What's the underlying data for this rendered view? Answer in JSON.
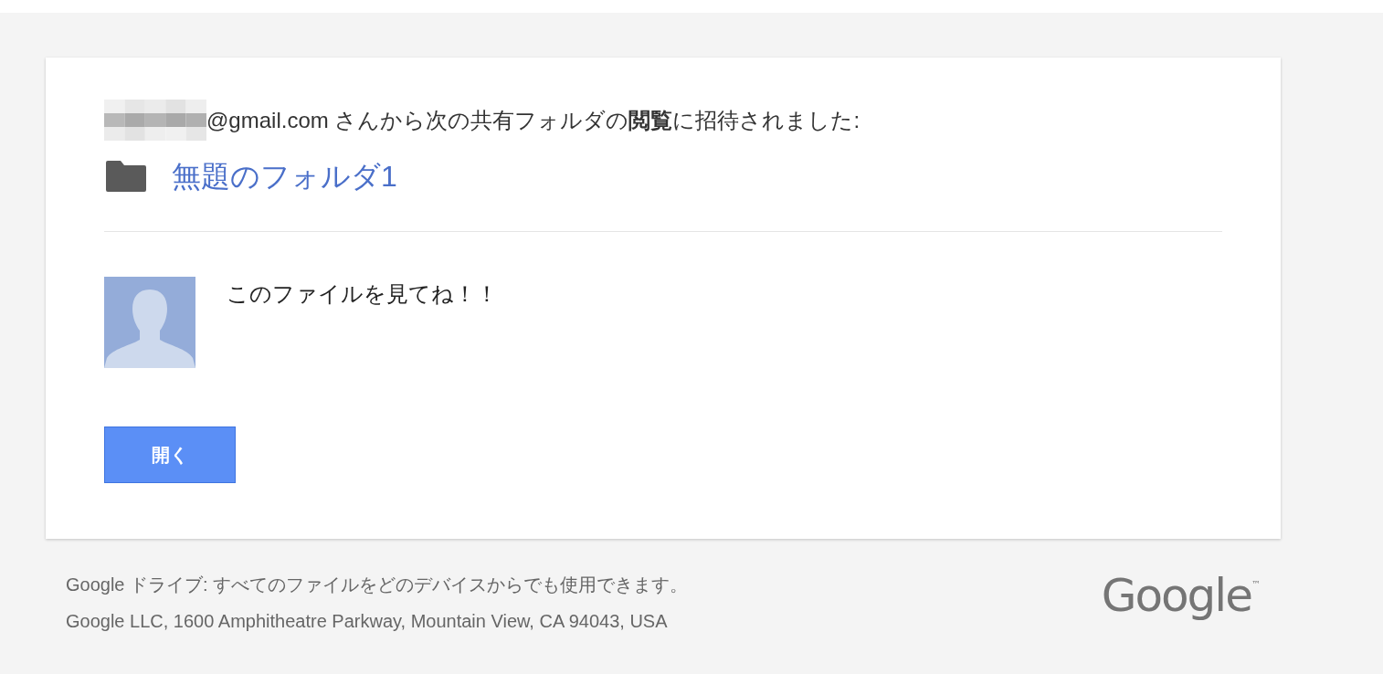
{
  "invite": {
    "sentence": "@gmail.com さんから次の共有フォルダの**閲覧**に招待されました:"
  },
  "folder": {
    "name": "無題のフォルダ1"
  },
  "message": {
    "text": "このファイルを見てね！！"
  },
  "open_button": {
    "label": "開く"
  },
  "footer": {
    "lines": [
      "Google ドライブ: すべてのファイルをどのデバイスからでも使用できます。",
      "Google LLC, 1600 Amphitheatre Parkway, Mountain View, CA 94043, USA"
    ],
    "logo": {
      "text": "Google",
      "mark": "™"
    }
  }
}
